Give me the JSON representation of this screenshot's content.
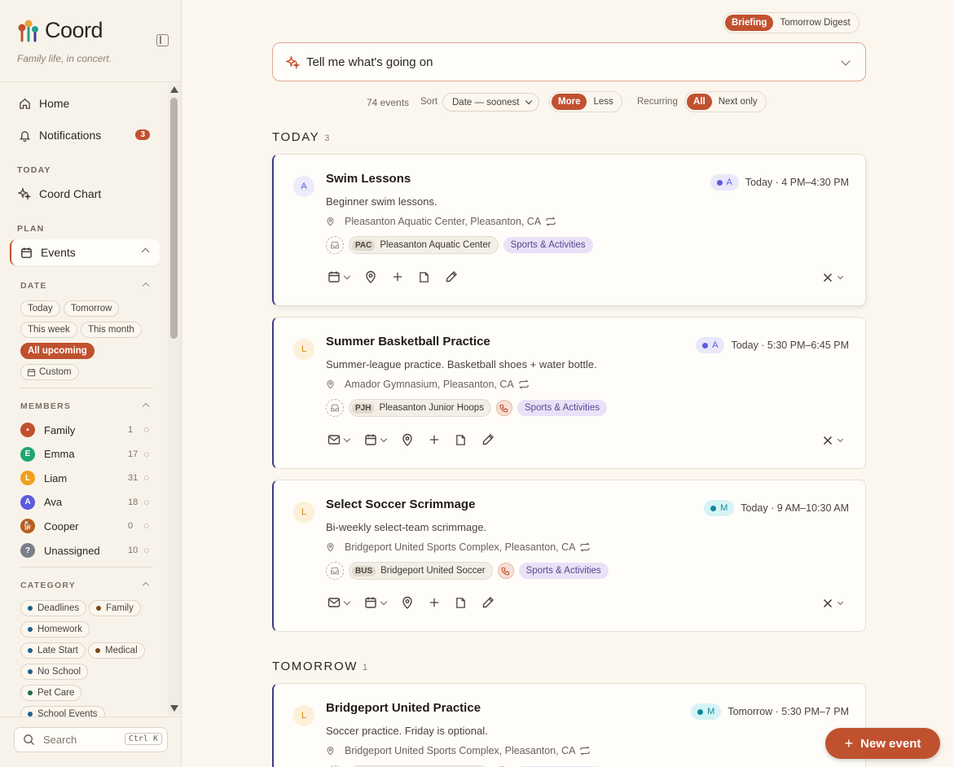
{
  "app": {
    "name": "Coord",
    "tagline": "Family life, in concert."
  },
  "sidebar": {
    "nav": [
      {
        "label": "Home",
        "icon": "home-icon"
      },
      {
        "label": "Notifications",
        "icon": "bell-icon",
        "badge": "3"
      }
    ],
    "today_label": "TODAY",
    "today_items": [
      {
        "label": "Coord Chart",
        "icon": "sparkle-icon"
      }
    ],
    "plan_label": "PLAN",
    "plan_items": [
      {
        "label": "Events",
        "icon": "calendar-icon",
        "active": true
      }
    ],
    "date_filter": {
      "label": "DATE",
      "chips": [
        "Today",
        "Tomorrow",
        "This week",
        "This month",
        "All upcoming",
        "Custom"
      ],
      "selected": "All upcoming"
    },
    "members_filter": {
      "label": "MEMBERS",
      "items": [
        {
          "name": "Family",
          "initial": "•",
          "count": "1",
          "color": "#c0512f"
        },
        {
          "name": "Emma",
          "initial": "E",
          "count": "17",
          "color": "#1ea672"
        },
        {
          "name": "Liam",
          "initial": "L",
          "count": "31",
          "color": "#f0a020"
        },
        {
          "name": "Ava",
          "initial": "A",
          "count": "18",
          "color": "#5b5be0"
        },
        {
          "name": "Cooper",
          "initial": "🐕",
          "count": "0",
          "color": "#b85d1e"
        },
        {
          "name": "Unassigned",
          "initial": "?",
          "count": "10",
          "color": "#7a7f89"
        }
      ]
    },
    "category_filter": {
      "label": "CATEGORY",
      "chips": [
        {
          "label": "Deadlines",
          "color": "#1e5f8a"
        },
        {
          "label": "Family",
          "color": "#7a4a12"
        },
        {
          "label": "Homework",
          "color": "#1e5f8a"
        },
        {
          "label": "Late Start",
          "color": "#1e5f8a"
        },
        {
          "label": "Medical",
          "color": "#7a4a12"
        },
        {
          "label": "No School",
          "color": "#1e5f8a"
        },
        {
          "label": "Pet Care",
          "color": "#1e6a4a"
        },
        {
          "label": "School Events",
          "color": "#1e5f8a"
        }
      ]
    },
    "search": {
      "placeholder": "Search",
      "shortcut": "Ctrl K"
    }
  },
  "header": {
    "view_toggle": {
      "options": [
        "Briefing",
        "Tomorrow Digest"
      ],
      "selected": "Briefing"
    },
    "assistant_prompt": "Tell me what's going on"
  },
  "filters": {
    "event_count": "74 events",
    "sort_label": "Sort",
    "sort_value": "Date — soonest",
    "density": {
      "options": [
        "More",
        "Less"
      ],
      "selected": "More"
    },
    "recurring_label": "Recurring",
    "recurring": {
      "options": [
        "All",
        "Next only"
      ],
      "selected": "All"
    }
  },
  "groups": [
    {
      "title": "TODAY",
      "count": "3",
      "events": [
        {
          "title": "Swim Lessons",
          "lead_initial": "A",
          "lead_color": "#5b5be0",
          "lead_bg": "#ecebfb",
          "description": "Beginner swim lessons.",
          "location": "Pleasanton Aquatic Center, Pleasanton, CA",
          "org_abbr": "PAC",
          "org_name": "Pleasanton Aquatic Center",
          "has_phone": false,
          "category": "Sports & Activities",
          "member_badge": "A",
          "member_color": "#5b5be0",
          "member_bg": "#e9e8fb",
          "when": "Today · 4 PM–4:30 PM",
          "has_email": false
        },
        {
          "title": "Summer Basketball Practice",
          "lead_initial": "L",
          "lead_color": "#d48a10",
          "lead_bg": "#fdf0d8",
          "description": "Summer-league practice. Basketball shoes + water bottle.",
          "location": "Amador Gymnasium, Pleasanton, CA",
          "org_abbr": "PJH",
          "org_name": "Pleasanton Junior Hoops",
          "has_phone": true,
          "category": "Sports & Activities",
          "member_badge": "A",
          "member_color": "#5b5be0",
          "member_bg": "#e9e8fb",
          "when": "Today · 5:30 PM–6:45 PM",
          "has_email": true
        },
        {
          "title": "Select Soccer Scrimmage",
          "lead_initial": "L",
          "lead_color": "#d48a10",
          "lead_bg": "#fdf0d8",
          "description": "Bi-weekly select-team scrimmage.",
          "location": "Bridgeport United Sports Complex, Pleasanton, CA",
          "org_abbr": "BUS",
          "org_name": "Bridgeport United Soccer",
          "has_phone": true,
          "category": "Sports & Activities",
          "member_badge": "M",
          "member_color": "#0e8a9a",
          "member_bg": "#d6f3f6",
          "when": "Today · 9 AM–10:30 AM",
          "has_email": true
        }
      ]
    },
    {
      "title": "TOMORROW",
      "count": "1",
      "events": [
        {
          "title": "Bridgeport United Practice",
          "lead_initial": "L",
          "lead_color": "#d48a10",
          "lead_bg": "#fdf0d8",
          "description": "Soccer practice. Friday is optional.",
          "location": "Bridgeport United Sports Complex, Pleasanton, CA",
          "member_badge": "M",
          "member_color": "#0e8a9a",
          "member_bg": "#d6f3f6",
          "when": "Tomorrow · 5:30 PM–7 PM"
        }
      ]
    }
  ],
  "new_event_label": "New event",
  "colors": {
    "accent": "#c0512f",
    "card_border": "#3d3a8a",
    "background": "#fbf6ee"
  }
}
